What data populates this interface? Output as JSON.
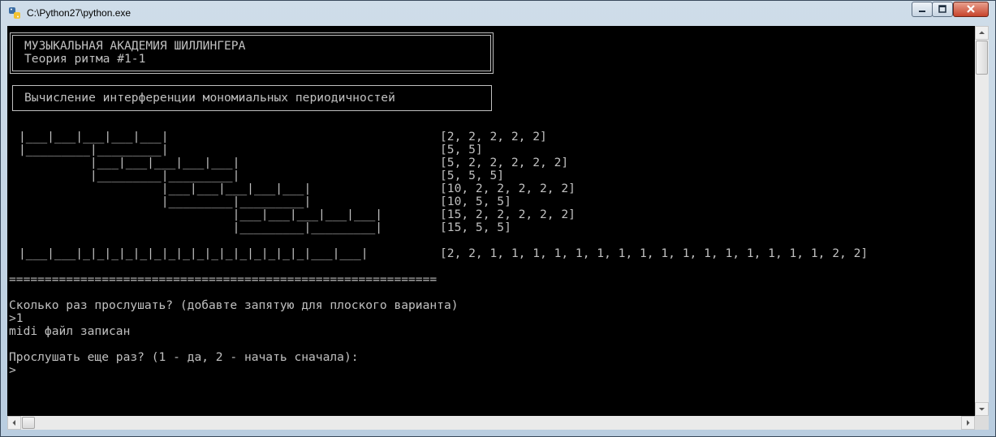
{
  "window": {
    "title": "C:\\Python27\\python.exe",
    "icon": "python-icon",
    "controls": [
      "minimize-icon",
      "maximize-icon",
      "close-icon"
    ]
  },
  "console": {
    "header_line1": "МУЗЫКАЛЬНАЯ АКАДЕМИЯ ШИЛЛИНГЕРА",
    "header_line2": "Теория ритма #1-1",
    "subtitle": "Вычисление интерференции мономиальных периодичностей",
    "rhythm_rows": [
      {
        "graph": "|___|___|___|___|___|",
        "values": "[2, 2, 2, 2, 2]"
      },
      {
        "graph": "|_________|_________|",
        "values": "[5, 5]"
      },
      {
        "graph": "          |___|___|___|___|___|",
        "values": "[5, 2, 2, 2, 2, 2]"
      },
      {
        "graph": "          |_________|_________|",
        "values": "[5, 5, 5]"
      },
      {
        "graph": "                    |___|___|___|___|___|",
        "values": "[10, 2, 2, 2, 2, 2]"
      },
      {
        "graph": "                    |_________|_________|",
        "values": "[10, 5, 5]"
      },
      {
        "graph": "                              |___|___|___|___|___|",
        "values": "[15, 2, 2, 2, 2, 2]"
      },
      {
        "graph": "                              |_________|_________|",
        "values": "[15, 5, 5]"
      }
    ],
    "result": {
      "graph": "|___|___|_|_|_|_|_|_|_|_|_|_|_|_|_|_|_|_|___|___|",
      "values": "[2, 2, 1, 1, 1, 1, 1, 1, 1, 1, 1, 1, 1, 1, 1, 1, 1, 1, 2, 2]"
    },
    "separator": "============================================================",
    "prompt_repeat": "Сколько раз прослушать? (добавте запятую для плоского варианта)",
    "input_repeat": ">1",
    "status_midi": "midi файл записан",
    "prompt_again": "Прослушать еще раз? (1 - да, 2 - начать сначала):",
    "input_prompt": ">"
  }
}
